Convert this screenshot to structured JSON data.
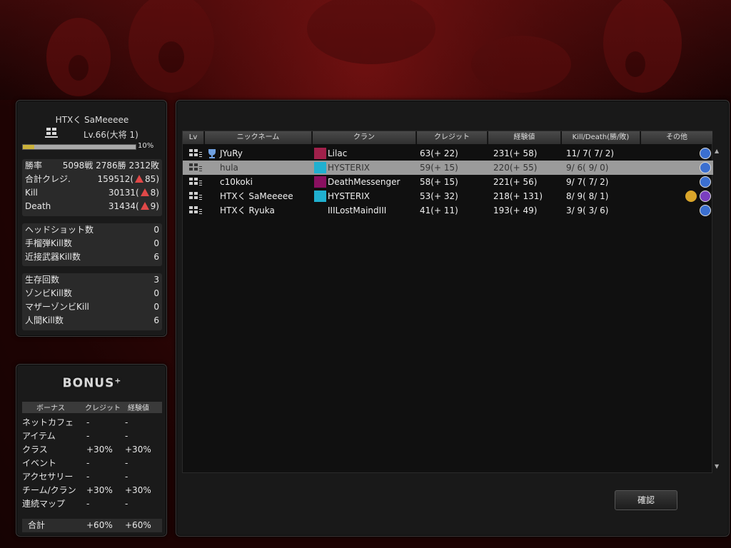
{
  "profile": {
    "name": "HTXく SaMeeeee",
    "level": "Lv.66(大将 1)",
    "xp_percent_label": "10%",
    "xp_fraction": 0.1,
    "stats": [
      {
        "label": "勝率",
        "value": "5098戦 2786勝 2312敗"
      },
      {
        "label": "合計クレジ.",
        "value": "159512(",
        "delta": "85)"
      },
      {
        "label": "Kill",
        "value": "30131(",
        "delta": "8)"
      },
      {
        "label": "Death",
        "value": "31434(",
        "delta": "9)"
      }
    ],
    "combat": [
      {
        "label": "ヘッドショット数",
        "value": "0"
      },
      {
        "label": "手榴弾Kill数",
        "value": "0"
      },
      {
        "label": "近接武器Kill数",
        "value": "6"
      }
    ],
    "zombie": [
      {
        "label": "生存回数",
        "value": "3"
      },
      {
        "label": "ゾンビKill数",
        "value": "0"
      },
      {
        "label": "マザーゾンビKill",
        "value": "0"
      },
      {
        "label": "人間Kill数",
        "value": "6"
      }
    ]
  },
  "bonus": {
    "title": "BONUS⁺",
    "headers": {
      "name": "ボーナス",
      "credit": "クレジット",
      "exp": "経験値"
    },
    "rows": [
      {
        "name": "ネットカフェ",
        "credit": "-",
        "exp": "-"
      },
      {
        "name": "アイテム",
        "credit": "-",
        "exp": "-"
      },
      {
        "name": "クラス",
        "credit": "+30%",
        "exp": "+30%"
      },
      {
        "name": "イベント",
        "credit": "-",
        "exp": "-"
      },
      {
        "name": "アクセサリー",
        "credit": "-",
        "exp": "-"
      },
      {
        "name": "チーム/クラン",
        "credit": "+30%",
        "exp": "+30%"
      },
      {
        "name": "連続マップ",
        "credit": "-",
        "exp": "-"
      }
    ],
    "total": {
      "name": "合計",
      "credit": "+60%",
      "exp": "+60%"
    }
  },
  "scoreboard": {
    "headers": {
      "lv": "Lv",
      "nickname": "ニックネーム",
      "clan": "クラン",
      "credit": "クレジット",
      "exp": "経験値",
      "kd": "Kill/Death(勝/敗)",
      "other": "その他"
    },
    "players": [
      {
        "nickname": "JYuRy",
        "clan": "Lilac",
        "credit": "63(+ 22)",
        "exp": "231(+ 58)",
        "kd": "11/ 7( 7/ 2)",
        "trophy": true,
        "selected": false,
        "clan_color": "#a0204a",
        "has_clan_icon": true
      },
      {
        "nickname": "hula",
        "clan": "HYSTERIX",
        "credit": "59(+ 15)",
        "exp": "220(+ 55)",
        "kd": "9/ 6( 9/ 0)",
        "trophy": false,
        "selected": true,
        "clan_color": "#20b0d0",
        "has_clan_icon": true
      },
      {
        "nickname": "c10koki",
        "clan": "DeathMessenger",
        "credit": "58(+ 15)",
        "exp": "221(+ 56)",
        "kd": "9/ 7( 7/ 2)",
        "trophy": false,
        "selected": false,
        "clan_color": "#8a1060",
        "has_clan_icon": true
      },
      {
        "nickname": "HTXく SaMeeeee",
        "clan": "HYSTERIX",
        "credit": "53(+ 32)",
        "exp": "218(+ 131)",
        "kd": "8/ 9( 8/ 1)",
        "trophy": false,
        "selected": false,
        "clan_color": "#20b0d0",
        "has_clan_icon": true
      },
      {
        "nickname": "HTXく Ryuka",
        "clan": "IIILostMaindIII",
        "credit": "41(+ 11)",
        "exp": "193(+ 49)",
        "kd": "3/ 9( 3/ 6)",
        "trophy": false,
        "selected": false,
        "clan_color": "",
        "has_clan_icon": false
      }
    ]
  },
  "confirm_label": "確認"
}
